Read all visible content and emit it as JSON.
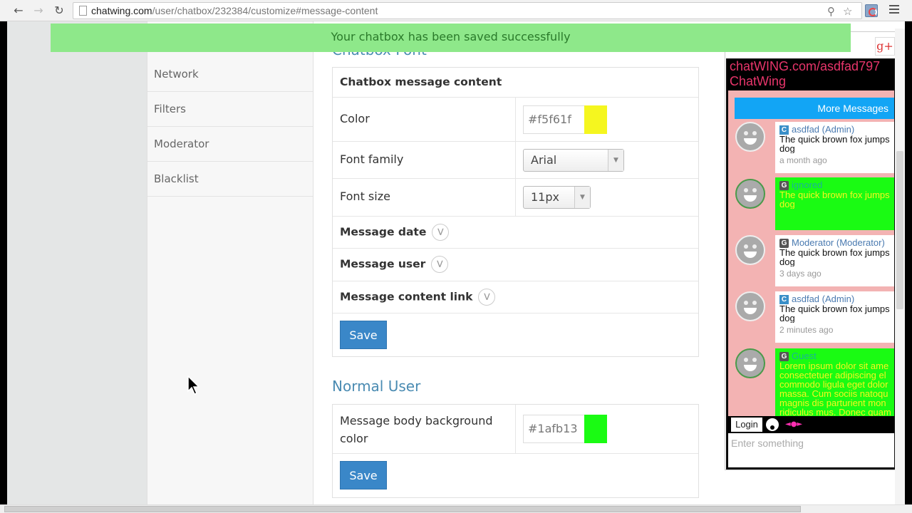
{
  "browser": {
    "url_host": "chatwing.com",
    "url_path": "/user/chatbox/232384/customize#message-content",
    "back_icon": "arrow-left",
    "forward_icon": "arrow-right",
    "reload_icon": "reload",
    "zoom_icon": "magnifier-plus",
    "bookmark_icon": "star-outline",
    "menu_icon": "hamburger"
  },
  "toast": {
    "message": "Your chatbox has been saved successfully",
    "color": "#8ee88a"
  },
  "sidebar": {
    "items": [
      {
        "label": "Network"
      },
      {
        "label": "Filters"
      },
      {
        "label": "Moderator"
      },
      {
        "label": "Blacklist"
      }
    ]
  },
  "main": {
    "font_section": {
      "title": "Chatbox Font",
      "panel_header": "Chatbox message content",
      "color_label": "Color",
      "color_value": "#f5f61f",
      "font_family_label": "Font family",
      "font_family_value": "Arial",
      "font_size_label": "Font size",
      "font_size_value": "11px",
      "collapsibles": [
        {
          "label": "Message date"
        },
        {
          "label": "Message user"
        },
        {
          "label": "Message content link"
        }
      ],
      "save_label": "Save"
    },
    "normal_user_section": {
      "title": "Normal User",
      "bg_color_label": "Message body background color",
      "bg_color_value": "#1afb13",
      "save_label": "Save"
    }
  },
  "chatbox_preview": {
    "gplus_label": "g+",
    "title_line1": "chatWING.com/asdfad797",
    "title_line2": "ChatWing",
    "more_messages_label": "More Messages",
    "messages": [
      {
        "badge": "C",
        "user": "asdfad (Admin)",
        "text": "The quick brown fox jumps\ndog",
        "time": "a month ago"
      },
      {
        "badge": "G",
        "user": "ignored",
        "text": "The quick brown fox jumps\ndog",
        "time": ""
      },
      {
        "badge": "G",
        "user": "Moderator (Moderator)",
        "text": "The quick brown fox jumps\ndog",
        "time": "3 days ago"
      },
      {
        "badge": "C",
        "user": "asdfad (Admin)",
        "text": "The quick brown fox jumps\ndog",
        "time": "2 minutes ago"
      },
      {
        "badge": "G",
        "user": "Guest",
        "text": "Lorem ipsum dolor sit ame\nconsectetuer adipiscing el\ncommodo ligula eget dolor\nmassa. Cum sociis natoqu\nmagnis dis parturient mon\nridiculus mus. Donec quam",
        "time": ""
      }
    ],
    "login_label": "Login",
    "input_placeholder": "Enter something"
  }
}
